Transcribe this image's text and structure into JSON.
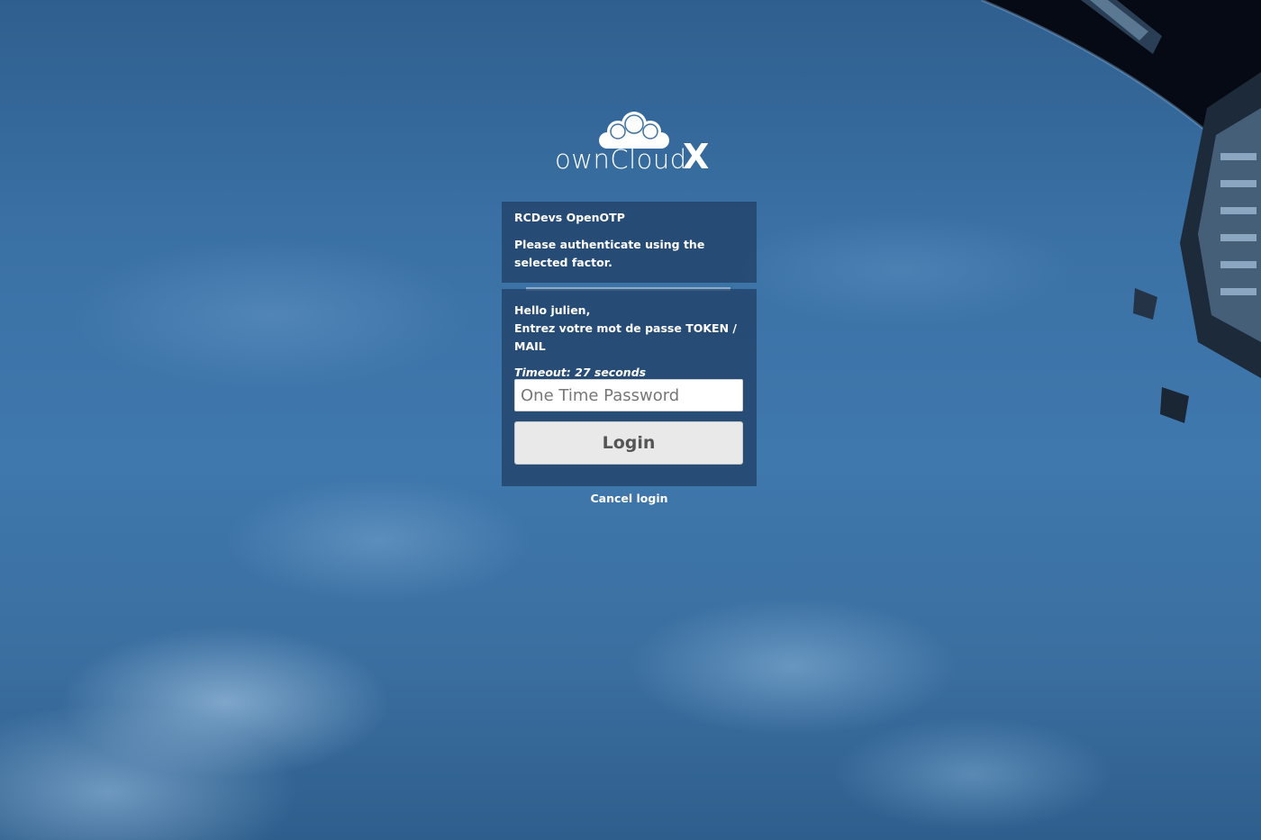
{
  "logo": {
    "text": "ownCloud",
    "suffix": "X"
  },
  "header_panel": {
    "title": "RCDevs OpenOTP",
    "message": "Please authenticate using the selected factor."
  },
  "form_panel": {
    "greeting": "Hello julien,",
    "prompt": "Entrez votre mot de passe TOKEN / MAIL",
    "timeout": "Timeout: 27 seconds",
    "password_input": {
      "value": "",
      "placeholder": "One Time Password"
    },
    "login_label": "Login"
  },
  "cancel_label": "Cancel login",
  "colors": {
    "panel_bg": "#1f3d62",
    "background": "#3b72a6",
    "button_bg": "#e9e9e9"
  }
}
